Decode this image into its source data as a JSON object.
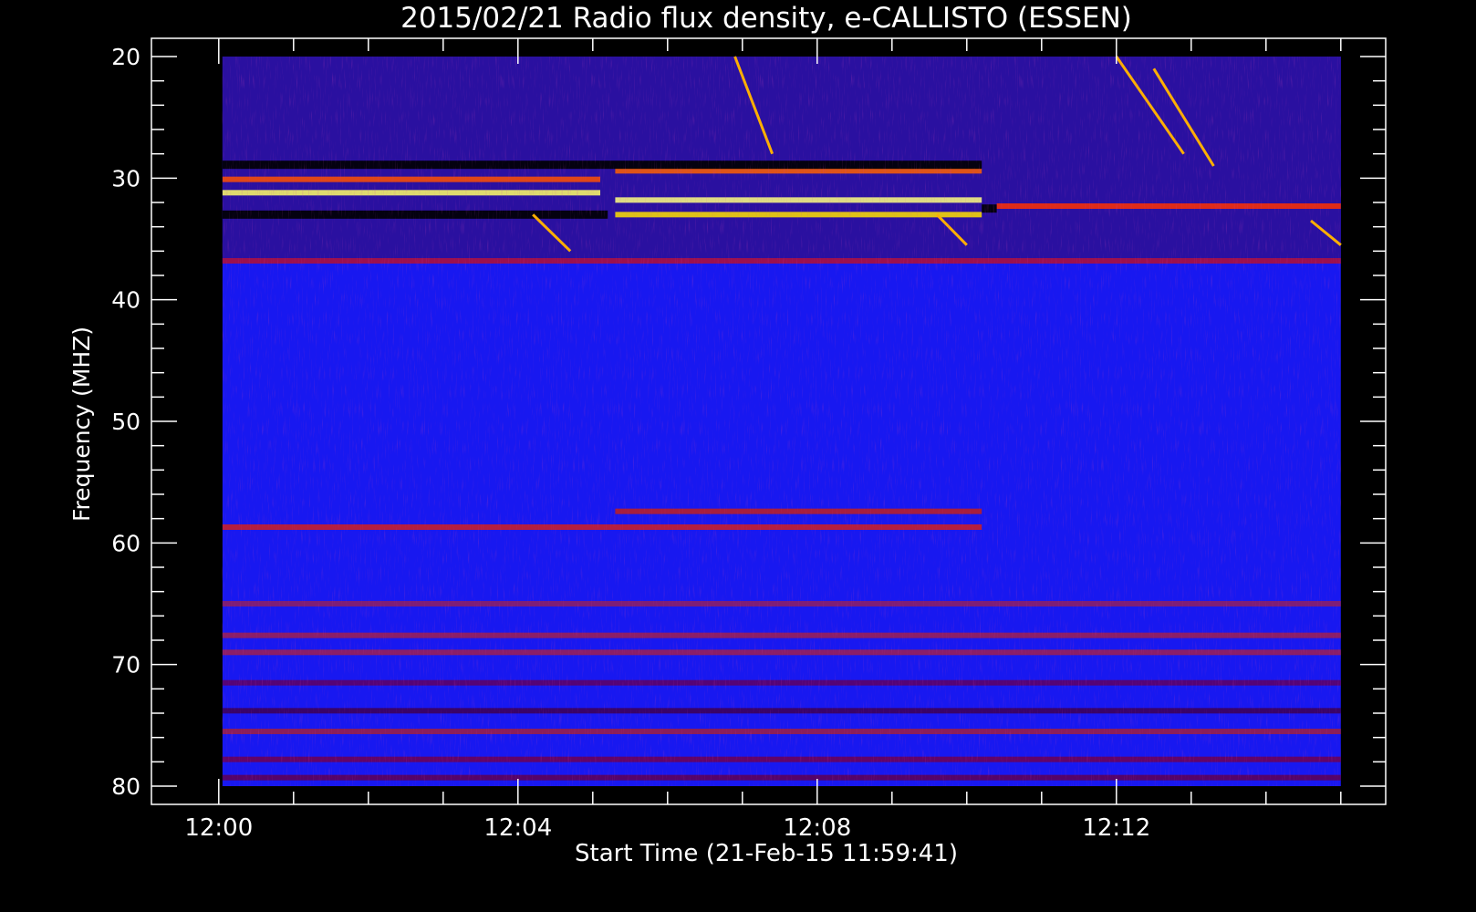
{
  "chart_data": {
    "type": "heatmap",
    "title": "2015/02/21  Radio flux density, e-CALLISTO (ESSEN)",
    "xlabel": "Start Time (21-Feb-15 11:59:41)",
    "ylabel": "Frequency (MHZ)",
    "x_ticks": [
      {
        "label": "12:00",
        "minutes": 0
      },
      {
        "label": "12:04",
        "minutes": 4
      },
      {
        "label": "12:08",
        "minutes": 8
      },
      {
        "label": "12:12",
        "minutes": 12
      }
    ],
    "y_ticks": [
      20,
      30,
      40,
      50,
      60,
      70,
      80
    ],
    "xlim_minutes": [
      -0.9,
      15.6
    ],
    "data_x_minutes": [
      0.05,
      15.0
    ],
    "ylim_mhz": [
      18.5,
      81.5
    ],
    "y_inverted": true,
    "colormap": [
      "#000000",
      "#0000ff",
      "#ff2000",
      "#ffff00",
      "#ffffff"
    ],
    "background_level": "#1818f0",
    "features": [
      {
        "kind": "band",
        "f_mhz": 31.2,
        "t_start": 0.05,
        "t_end": 5.1,
        "color": "#ffff66"
      },
      {
        "kind": "band",
        "f_mhz": 30.1,
        "t_start": 0.05,
        "t_end": 5.1,
        "color": "#ff5000"
      },
      {
        "kind": "band",
        "f_mhz": 31.8,
        "t_start": 5.3,
        "t_end": 10.2,
        "color": "#ffff80"
      },
      {
        "kind": "band",
        "f_mhz": 33.0,
        "t_start": 5.3,
        "t_end": 10.2,
        "color": "#ffe000"
      },
      {
        "kind": "band",
        "f_mhz": 29.4,
        "t_start": 5.3,
        "t_end": 10.2,
        "color": "#ff6000"
      },
      {
        "kind": "band",
        "f_mhz": 32.3,
        "t_start": 10.4,
        "t_end": 15.0,
        "color": "#ff3000"
      },
      {
        "kind": "dark",
        "f_mhz": 28.9,
        "t_start": 0.05,
        "t_end": 10.2
      },
      {
        "kind": "dark",
        "f_mhz": 33.0,
        "t_start": 0.05,
        "t_end": 5.2
      },
      {
        "kind": "dark",
        "f_mhz": 32.5,
        "t_start": 10.2,
        "t_end": 10.4
      },
      {
        "kind": "band",
        "f_mhz": 36.8,
        "t_start": 0.05,
        "t_end": 15.0,
        "color": "#b01040"
      },
      {
        "kind": "band",
        "f_mhz": 58.7,
        "t_start": 0.05,
        "t_end": 10.2,
        "color": "#d02020"
      },
      {
        "kind": "band",
        "f_mhz": 57.4,
        "t_start": 5.3,
        "t_end": 10.2,
        "color": "#c02020"
      },
      {
        "kind": "band",
        "f_mhz": 65.0,
        "t_start": 0.05,
        "t_end": 15.0,
        "color": "#902060"
      },
      {
        "kind": "band",
        "f_mhz": 67.6,
        "t_start": 0.05,
        "t_end": 15.0,
        "color": "#a02050"
      },
      {
        "kind": "band",
        "f_mhz": 69.0,
        "t_start": 0.05,
        "t_end": 15.0,
        "color": "#a02050"
      },
      {
        "kind": "band",
        "f_mhz": 71.5,
        "t_start": 0.05,
        "t_end": 15.0,
        "color": "#600060"
      },
      {
        "kind": "band",
        "f_mhz": 73.8,
        "t_start": 0.05,
        "t_end": 15.0,
        "color": "#400050"
      },
      {
        "kind": "band",
        "f_mhz": 75.5,
        "t_start": 0.05,
        "t_end": 15.0,
        "color": "#a02040"
      },
      {
        "kind": "band",
        "f_mhz": 77.8,
        "t_start": 0.05,
        "t_end": 15.0,
        "color": "#700050"
      },
      {
        "kind": "band",
        "f_mhz": 79.3,
        "t_start": 0.05,
        "t_end": 15.0,
        "color": "#600050"
      }
    ],
    "bursts": [
      {
        "t_start": 6.9,
        "f_start": 20.0,
        "t_end": 7.4,
        "f_end": 28.0
      },
      {
        "t_start": 12.0,
        "f_start": 20.0,
        "t_end": 12.9,
        "f_end": 28.0
      },
      {
        "t_start": 12.5,
        "f_start": 21.0,
        "t_end": 13.3,
        "f_end": 29.0
      },
      {
        "t_start": 4.2,
        "f_start": 33.0,
        "t_end": 4.7,
        "f_end": 36.0
      },
      {
        "t_start": 9.6,
        "f_start": 33.0,
        "t_end": 10.0,
        "f_end": 35.5
      },
      {
        "t_start": 14.6,
        "f_start": 33.5,
        "t_end": 15.0,
        "f_end": 35.5
      }
    ]
  }
}
